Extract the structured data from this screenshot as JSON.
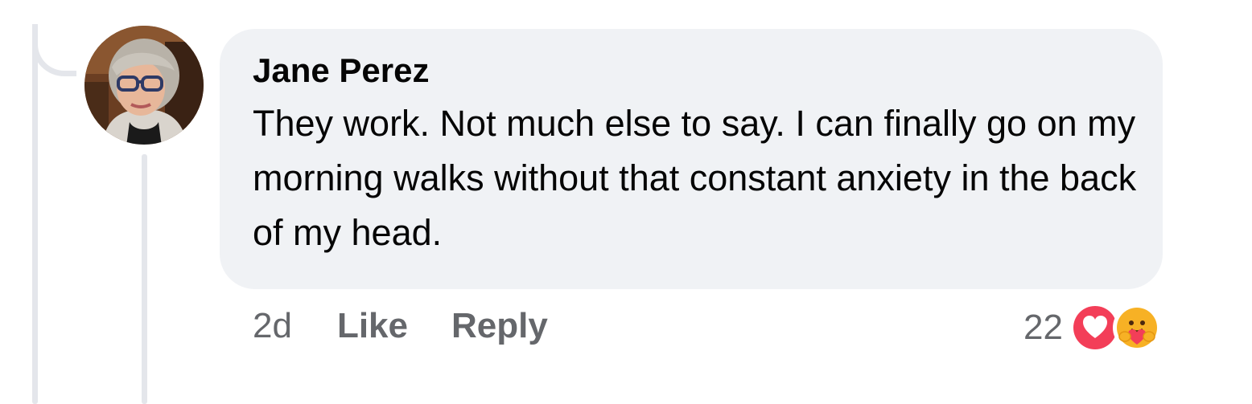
{
  "comment": {
    "author": "Jane Perez",
    "text": "They work. Not much else to say. I can finally go on my morning walks without that constant anxiety in the back of my head.",
    "timestamp": "2d",
    "like_label": "Like",
    "reply_label": "Reply",
    "reaction_count": "22",
    "reactions": [
      "heart-reaction-icon",
      "care-reaction-icon"
    ]
  },
  "colors": {
    "bubble": "#f0f2f5",
    "text": "#050505",
    "secondary_text": "#65676b",
    "thread_line": "#e4e6eb",
    "heart_reaction": "#f33e58",
    "care_reaction": "#f7b125"
  }
}
